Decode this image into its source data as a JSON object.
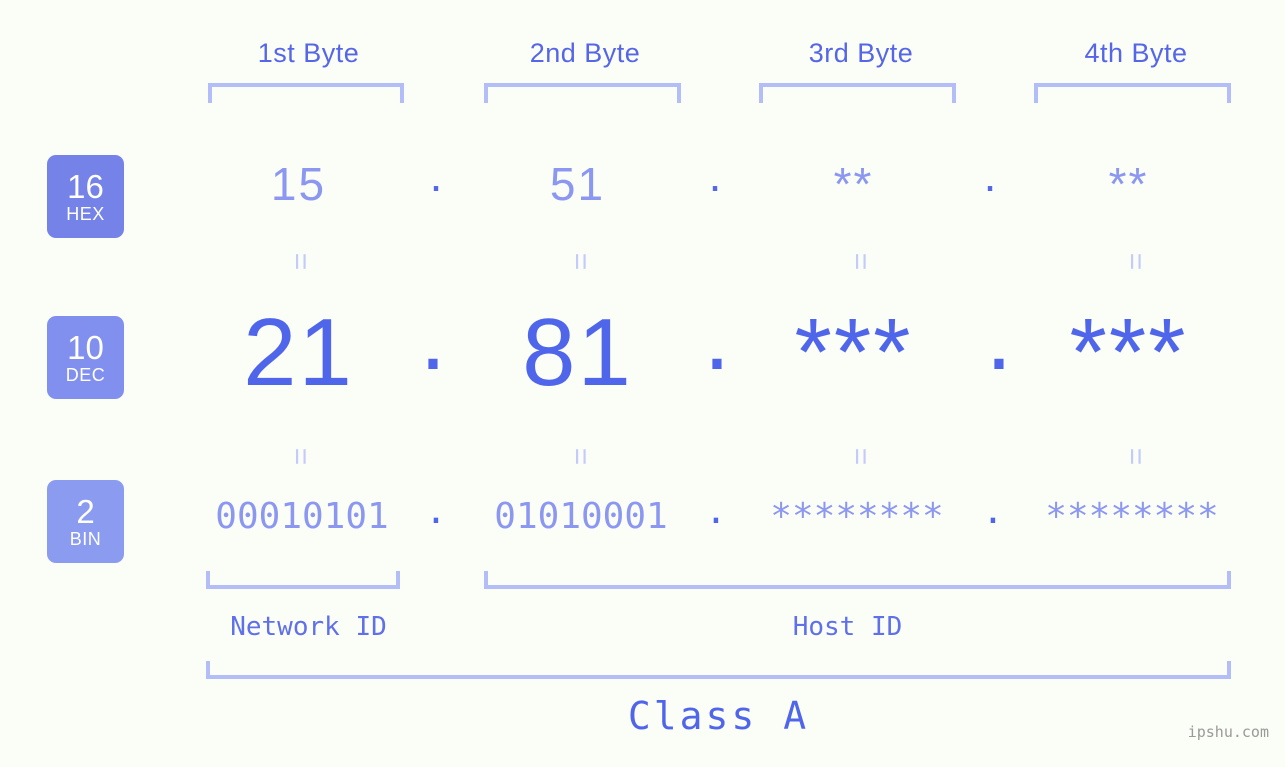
{
  "theme": {
    "background": "#fbfdf7",
    "accent_strong": "#5066ea",
    "accent_mid": "#5566e8",
    "accent_light": "#8b97f0",
    "bracket": "#b3bdf8",
    "equals": "#c4cbfa",
    "badge_hex_bg": "#7582e8",
    "badge_dec_bg": "#8190ee",
    "badge_bin_bg": "#8b9cf0",
    "watermark_color": "#9a9a9a"
  },
  "columns": [
    {
      "label": "1st Byte"
    },
    {
      "label": "2nd Byte"
    },
    {
      "label": "3rd Byte"
    },
    {
      "label": "4th Byte"
    }
  ],
  "bases": [
    {
      "number": "16",
      "name": "HEX"
    },
    {
      "number": "10",
      "name": "DEC"
    },
    {
      "number": "2",
      "name": "BIN"
    }
  ],
  "rows": {
    "hex": {
      "base_number": "16",
      "base_name": "HEX",
      "values": [
        "15",
        "51",
        "**",
        "**"
      ],
      "separator": "."
    },
    "dec": {
      "base_number": "10",
      "base_name": "DEC",
      "values": [
        "21",
        "81",
        "***",
        "***"
      ],
      "separator": "."
    },
    "bin": {
      "base_number": "2",
      "base_name": "BIN",
      "values": [
        "00010101",
        "01010001",
        "********",
        "********"
      ],
      "separator": "."
    }
  },
  "equals_glyph": "=",
  "segments": {
    "network_id": "Network ID",
    "host_id": "Host ID"
  },
  "class_label": "Class A",
  "watermark": "ipshu.com"
}
